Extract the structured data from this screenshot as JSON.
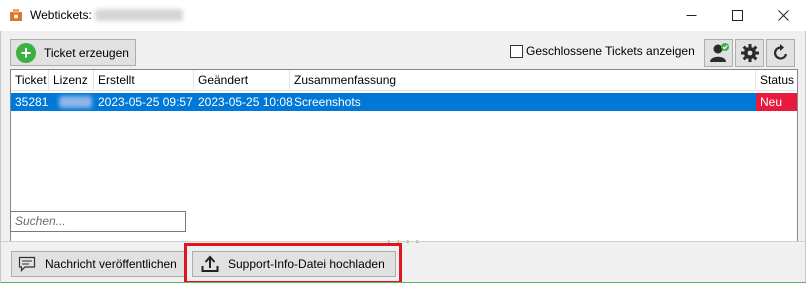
{
  "window": {
    "title": "Webtickets:",
    "minimize_glyph": "—",
    "maximize_glyph": "☐",
    "close_glyph": "✕"
  },
  "toolbar": {
    "create_ticket_label": "Ticket erzeugen",
    "show_closed_label": "Geschlossene Tickets anzeigen",
    "show_closed_checked": false,
    "icons": [
      "user-status-icon",
      "gear-icon",
      "refresh-icon"
    ]
  },
  "table": {
    "columns": [
      "Ticket",
      "Lizenz",
      "Erstellt",
      "Geändert",
      "Zusammenfassung",
      "Status"
    ],
    "rows": [
      {
        "ticket": "35281",
        "lizenz": "",
        "erstellt": "2023-05-25 09:57",
        "geaendert": "2023-05-25 10:08",
        "zusammenfassung": "Screenshots",
        "status": "Neu"
      }
    ]
  },
  "search": {
    "placeholder": "Suchen..."
  },
  "bottom": {
    "publish_message_label": "Nachricht veröffentlichen",
    "upload_support_info_label": "Support-Info-Datei hochladen"
  },
  "colors": {
    "selection": "#0078d7",
    "status_new": "#e8193c",
    "highlight_box": "#e0161e",
    "create_icon": "#3cb043"
  }
}
